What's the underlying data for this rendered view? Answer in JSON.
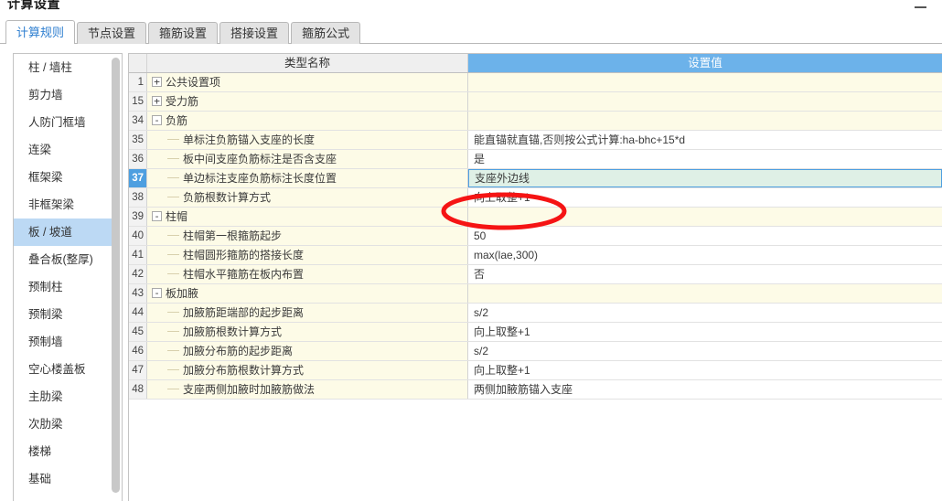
{
  "window": {
    "title": "计算设置",
    "minimize_label": "minimize"
  },
  "tabs": [
    {
      "label": "计算规则",
      "active": true
    },
    {
      "label": "节点设置",
      "active": false
    },
    {
      "label": "箍筋设置",
      "active": false
    },
    {
      "label": "搭接设置",
      "active": false
    },
    {
      "label": "箍筋公式",
      "active": false
    }
  ],
  "sidebar": {
    "items": [
      {
        "label": "柱 / 墙柱",
        "selected": false
      },
      {
        "label": "剪力墙",
        "selected": false
      },
      {
        "label": "人防门框墙",
        "selected": false
      },
      {
        "label": "连梁",
        "selected": false
      },
      {
        "label": "框架梁",
        "selected": false
      },
      {
        "label": "非框架梁",
        "selected": false
      },
      {
        "label": "板 / 坡道",
        "selected": true
      },
      {
        "label": "叠合板(整厚)",
        "selected": false
      },
      {
        "label": "预制柱",
        "selected": false
      },
      {
        "label": "预制梁",
        "selected": false
      },
      {
        "label": "预制墙",
        "selected": false
      },
      {
        "label": "空心楼盖板",
        "selected": false
      },
      {
        "label": "主肋梁",
        "selected": false
      },
      {
        "label": "次肋梁",
        "selected": false
      },
      {
        "label": "楼梯",
        "selected": false
      },
      {
        "label": "基础",
        "selected": false
      }
    ]
  },
  "grid": {
    "columns": {
      "row_number": "",
      "type_name": "类型名称",
      "setting_value": "设置值"
    },
    "rows": [
      {
        "num": "1",
        "toggle": "+",
        "kind": "group",
        "name": "公共设置项",
        "value": "",
        "selected": false
      },
      {
        "num": "15",
        "toggle": "+",
        "kind": "group",
        "name": "受力筋",
        "value": "",
        "selected": false
      },
      {
        "num": "34",
        "toggle": "-",
        "kind": "group",
        "name": "负筋",
        "value": "",
        "selected": false
      },
      {
        "num": "35",
        "toggle": "",
        "kind": "child",
        "name": "单标注负筋锚入支座的长度",
        "value": "能直锚就直锚,否则按公式计算:ha-bhc+15*d",
        "selected": false
      },
      {
        "num": "36",
        "toggle": "",
        "kind": "child",
        "name": "板中间支座负筋标注是否含支座",
        "value": "是",
        "selected": false
      },
      {
        "num": "37",
        "toggle": "",
        "kind": "child",
        "name": "单边标注支座负筋标注长度位置",
        "value": "支座外边线",
        "selected": true
      },
      {
        "num": "38",
        "toggle": "",
        "kind": "child",
        "name": "负筋根数计算方式",
        "value": "向上取整+1",
        "selected": false
      },
      {
        "num": "39",
        "toggle": "-",
        "kind": "group",
        "name": "柱帽",
        "value": "",
        "selected": false
      },
      {
        "num": "40",
        "toggle": "",
        "kind": "child",
        "name": "柱帽第一根箍筋起步",
        "value": "50",
        "selected": false
      },
      {
        "num": "41",
        "toggle": "",
        "kind": "child",
        "name": "柱帽圆形箍筋的搭接长度",
        "value": "max(lae,300)",
        "selected": false
      },
      {
        "num": "42",
        "toggle": "",
        "kind": "child",
        "name": "柱帽水平箍筋在板内布置",
        "value": "否",
        "selected": false
      },
      {
        "num": "43",
        "toggle": "-",
        "kind": "group",
        "name": "板加腋",
        "value": "",
        "selected": false
      },
      {
        "num": "44",
        "toggle": "",
        "kind": "child",
        "name": "加腋筋距端部的起步距离",
        "value": "s/2",
        "selected": false
      },
      {
        "num": "45",
        "toggle": "",
        "kind": "child",
        "name": "加腋筋根数计算方式",
        "value": "向上取整+1",
        "selected": false
      },
      {
        "num": "46",
        "toggle": "",
        "kind": "child",
        "name": "加腋分布筋的起步距离",
        "value": "s/2",
        "selected": false
      },
      {
        "num": "47",
        "toggle": "",
        "kind": "child",
        "name": "加腋分布筋根数计算方式",
        "value": "向上取整+1",
        "selected": false
      },
      {
        "num": "48",
        "toggle": "",
        "kind": "child",
        "name": "支座两侧加腋时加腋筋做法",
        "value": "两侧加腋筋锚入支座",
        "selected": false
      }
    ]
  },
  "annotation": {
    "shape": "ellipse",
    "color": "#f51414",
    "target_row_numbers": [
      "36",
      "37"
    ]
  },
  "colors": {
    "header_accent": "#6cb2ea",
    "selection_blue": "#4e9fe0",
    "sidebar_selection": "#bcd9f4",
    "group_row": "#fdfbe7",
    "selected_value_cell": "#dff0e6",
    "annotation_red": "#f51414"
  }
}
